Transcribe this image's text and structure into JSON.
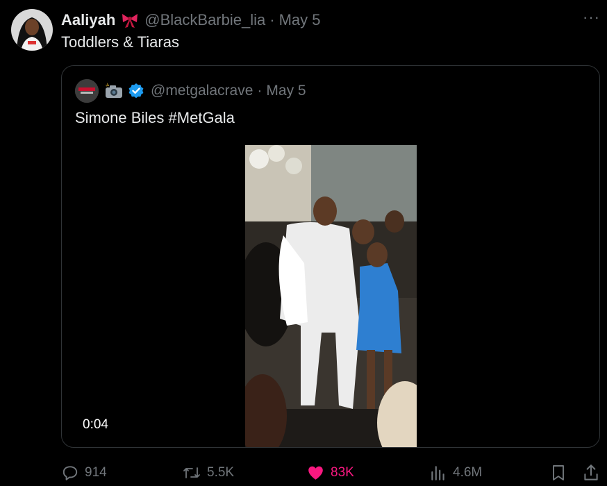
{
  "tweet": {
    "author_name": "Aaliyah",
    "author_emoji": "bow-icon",
    "handle": "@BlackBarbie_lia",
    "separator": "·",
    "date": "May 5",
    "text": "Toddlers & Tiaras",
    "more": "···"
  },
  "quoted_tweet": {
    "avatar_label": "METGALA CRAVE",
    "emoji": "camera-flash-icon",
    "verified": "verified-badge-icon",
    "handle": "@metgalacrave",
    "separator": "·",
    "date": "May 5",
    "text": "Simone Biles #MetGala",
    "video_duration": "0:04"
  },
  "actions": {
    "replies": "914",
    "reposts": "5.5K",
    "likes": "83K",
    "views": "4.6M"
  },
  "colors": {
    "background": "#000000",
    "text": "#e7e9ea",
    "muted": "#71767b",
    "like": "#f91880",
    "verified": "#1d9bf0",
    "border": "#2f3336"
  }
}
